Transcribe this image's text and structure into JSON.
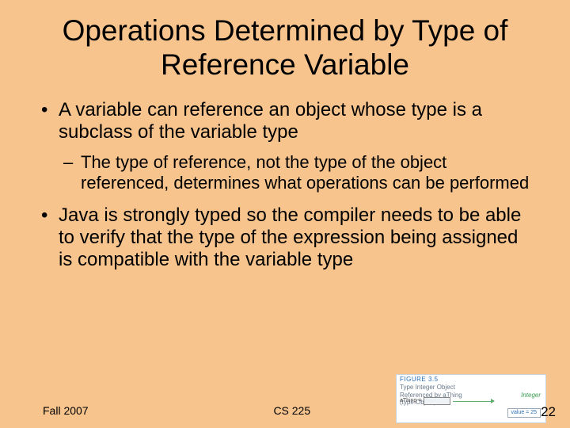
{
  "title": "Operations Determined by Type of Reference Variable",
  "bullets": {
    "b1": "A variable can reference an object whose type is a subclass of the variable type",
    "b1sub": "The type of reference, not the type of the object referenced, determines what operations can be performed",
    "b2": "Java is strongly typed so the compiler needs to be able to verify that the type of the expression being assigned is compatible with the variable type"
  },
  "footer": {
    "left": "Fall 2007",
    "center": "CS 225",
    "page": "22"
  },
  "figure": {
    "label": "FIGURE 3.5",
    "title_line1": "Type Integer Object",
    "title_line2": "Referenced by aThing",
    "title_line3": "(type Object)",
    "var": "aThing =",
    "class": "Integer",
    "value": "value = 25"
  }
}
